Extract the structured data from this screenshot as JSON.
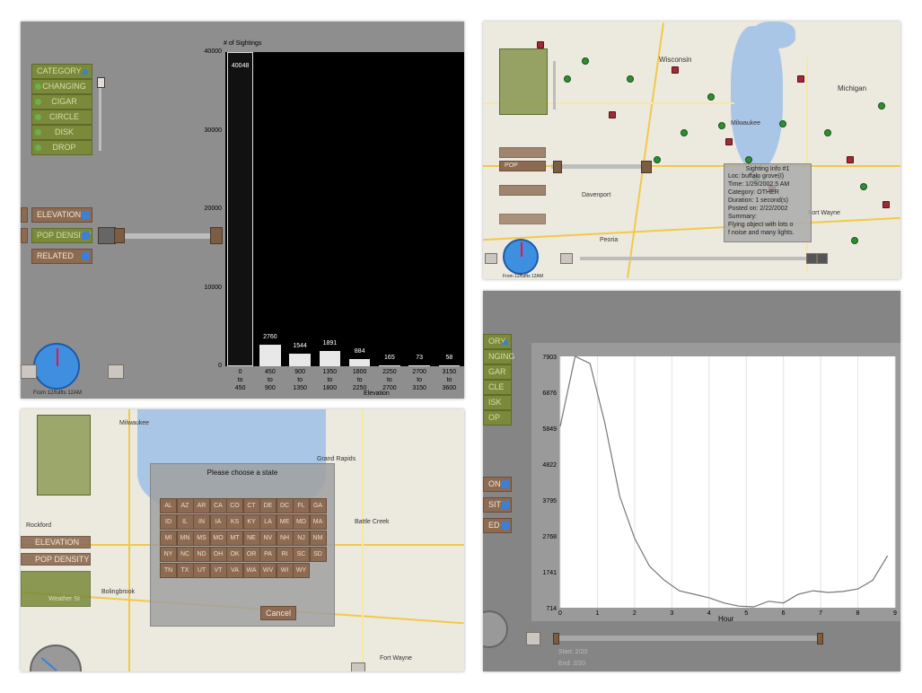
{
  "panel1": {
    "category_button": "CATEGORY",
    "shapes": [
      "CHANGING",
      "CIGAR",
      "CIRCLE",
      "DISK",
      "DROP"
    ],
    "elevation_button": "ELEVATION",
    "pop_density_button": "POP DENSITY",
    "related_button": "RELATED",
    "clock_caption": "From 12/fulfts 12AM",
    "chart_data": {
      "type": "bar",
      "ylabel": "# of Sightings",
      "xlabel": "Elevation",
      "ylim": [
        0,
        40000
      ],
      "yticks": [
        "40000",
        "30000",
        "20000",
        "10000",
        "0"
      ],
      "categories": [
        "0\nto\n450",
        "450\nto\n900",
        "900\nto\n1350",
        "1350\nto\n1800",
        "1800\nto\n2250",
        "2250\nto\n2700",
        "2700\nto\n3150",
        "3150\nto\n3600"
      ],
      "values": [
        40048,
        2760,
        1544,
        1891,
        884,
        165,
        73,
        58
      ],
      "value_labels": [
        "40048",
        "2760",
        "1544",
        "1891",
        "884",
        "165",
        "73",
        "58"
      ]
    }
  },
  "panel2": {
    "pop_density_button": "POP DENSITY",
    "cities": [
      "Wisconsin",
      "Milwaukee",
      "Michigan",
      "Davenport",
      "Fort Wayne",
      "Peoria"
    ],
    "info": {
      "title": "Sighting Info #1",
      "lines": [
        "Loc: buffalo grove(I)",
        "Time: 1/29/2002 5 AM",
        "Category: OTHER",
        "Duration: 1 second(s)",
        "Posted on: 2/22/2002",
        "Summary:",
        "Flying object with lots o",
        "f noise and many lights."
      ]
    },
    "clock_caption": "From 12/fulfts 12AM"
  },
  "panel3": {
    "dialog_title": "Please choose a state",
    "states": [
      "AL",
      "AZ",
      "AR",
      "CA",
      "CO",
      "CT",
      "DE",
      "DC",
      "FL",
      "GA",
      "ID",
      "IL",
      "IN",
      "IA",
      "KS",
      "KY",
      "LA",
      "ME",
      "MD",
      "MA",
      "MI",
      "MN",
      "MS",
      "MO",
      "MT",
      "NE",
      "NV",
      "NH",
      "NJ",
      "NM",
      "NY",
      "NC",
      "ND",
      "OH",
      "OK",
      "OR",
      "PA",
      "RI",
      "SC",
      "SD",
      "TN",
      "TX",
      "UT",
      "VT",
      "VA",
      "WA",
      "WV",
      "WI",
      "WY"
    ],
    "cancel_button": "Cancel",
    "elevation_button": "ELEVATION",
    "pop_density_button": "POP DENSITY",
    "weather_button": "Weather St",
    "cities": [
      "Milwaukee",
      "Grand Rapids",
      "Battle Creek",
      "Rockford",
      "Fort Wayne",
      "Bolingbrook"
    ]
  },
  "panel4": {
    "category_button": "ORY",
    "shapes": [
      "NGING",
      "GAR",
      "CLE",
      "ISK",
      "OP"
    ],
    "elevation_button": "ON",
    "density_button": "SITY",
    "related_button": "ED",
    "start_label": "Start: 2/20",
    "end_label": "End: 2/20",
    "chart_data": {
      "type": "line",
      "xlabel": "Hour",
      "ylim": [
        714,
        7903
      ],
      "xlim": [
        0,
        9
      ],
      "yticks": [
        "7903",
        "6876",
        "5849",
        "4822",
        "3795",
        "2768",
        "1741",
        "714"
      ],
      "xticks": [
        "0",
        "1",
        "2",
        "3",
        "4",
        "5",
        "6",
        "7",
        "8",
        "9"
      ],
      "x": [
        0,
        0.4,
        0.8,
        1.2,
        1.6,
        2.0,
        2.4,
        2.8,
        3.2,
        3.6,
        4.0,
        4.4,
        4.8,
        5.2,
        5.6,
        6.0,
        6.4,
        6.8,
        7.2,
        7.6,
        8.0,
        8.4,
        8.8
      ],
      "y": [
        5900,
        7903,
        7700,
        6000,
        3900,
        2700,
        1900,
        1500,
        1200,
        1100,
        1000,
        850,
        760,
        740,
        900,
        850,
        1100,
        1200,
        1150,
        1180,
        1250,
        1500,
        2200
      ]
    }
  }
}
